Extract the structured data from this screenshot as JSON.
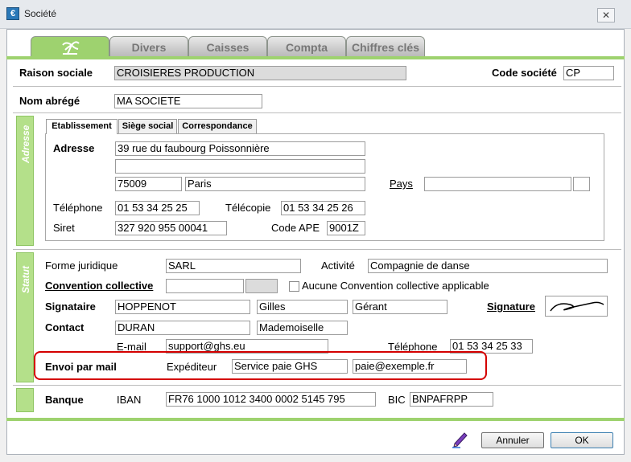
{
  "window": {
    "title": "Société",
    "app_icon": "€"
  },
  "tabs": [
    "",
    "Divers",
    "Caisses",
    "Compta",
    "Chiffres clés"
  ],
  "header": {
    "raison_sociale_label": "Raison sociale",
    "raison_sociale_value": "CROISIERES PRODUCTION",
    "code_societe_label": "Code société",
    "code_societe_value": "CP",
    "nom_abrege_label": "Nom abrégé",
    "nom_abrege_value": "MA SOCIETE"
  },
  "adresse": {
    "group_label": "Adresse",
    "subtabs": [
      "Etablissement",
      "Siège social",
      "Correspondance"
    ],
    "adresse_label": "Adresse",
    "line1": "39 rue du faubourg Poissonnière",
    "line2": "",
    "cp": "75009",
    "ville": "Paris",
    "pays_label": "Pays",
    "pays_value": "",
    "pays_code": "",
    "telephone_label": "Téléphone",
    "telephone_value": "01 53 34 25 25",
    "telecopie_label": "Télécopie",
    "telecopie_value": "01 53 34 25 26",
    "siret_label": "Siret",
    "siret_value": "327 920 955 00041",
    "code_ape_label": "Code APE",
    "code_ape_value": "9001Z"
  },
  "statut": {
    "group_label": "Statut",
    "forme_juridique_label": "Forme juridique",
    "forme_juridique_value": "SARL",
    "activite_label": "Activité",
    "activite_value": "Compagnie de danse",
    "convention_label": "Convention collective",
    "convention_value": "",
    "convention_code": "",
    "aucune_convention_label": "Aucune Convention collective applicable",
    "signataire_label": "Signataire",
    "signataire_nom": "HOPPENOT",
    "signataire_prenom": "Gilles",
    "signataire_fonction": "Gérant",
    "signature_label": "Signature",
    "contact_label": "Contact",
    "contact_nom": "DURAN",
    "contact_civilite": "Mademoiselle",
    "email_label": "E-mail",
    "email_value": "support@ghs.eu",
    "contact_tel_label": "Téléphone",
    "contact_tel_value": "01 53 34 25 33",
    "envoi_label": "Envoi par mail",
    "expediteur_label": "Expéditeur",
    "expediteur_nom": "Service paie GHS",
    "expediteur_email": "paie@exemple.fr"
  },
  "banque": {
    "label": "Banque",
    "iban_label": "IBAN",
    "iban_value": "FR76 1000 1012 3400 0002 5145 795",
    "bic_label": "BIC",
    "bic_value": "BNPAFRPP"
  },
  "footer": {
    "cancel_label": "Annuler",
    "ok_label": "OK"
  },
  "colors": {
    "accent_green": "#9ed26f",
    "highlight_red": "#d40000"
  }
}
